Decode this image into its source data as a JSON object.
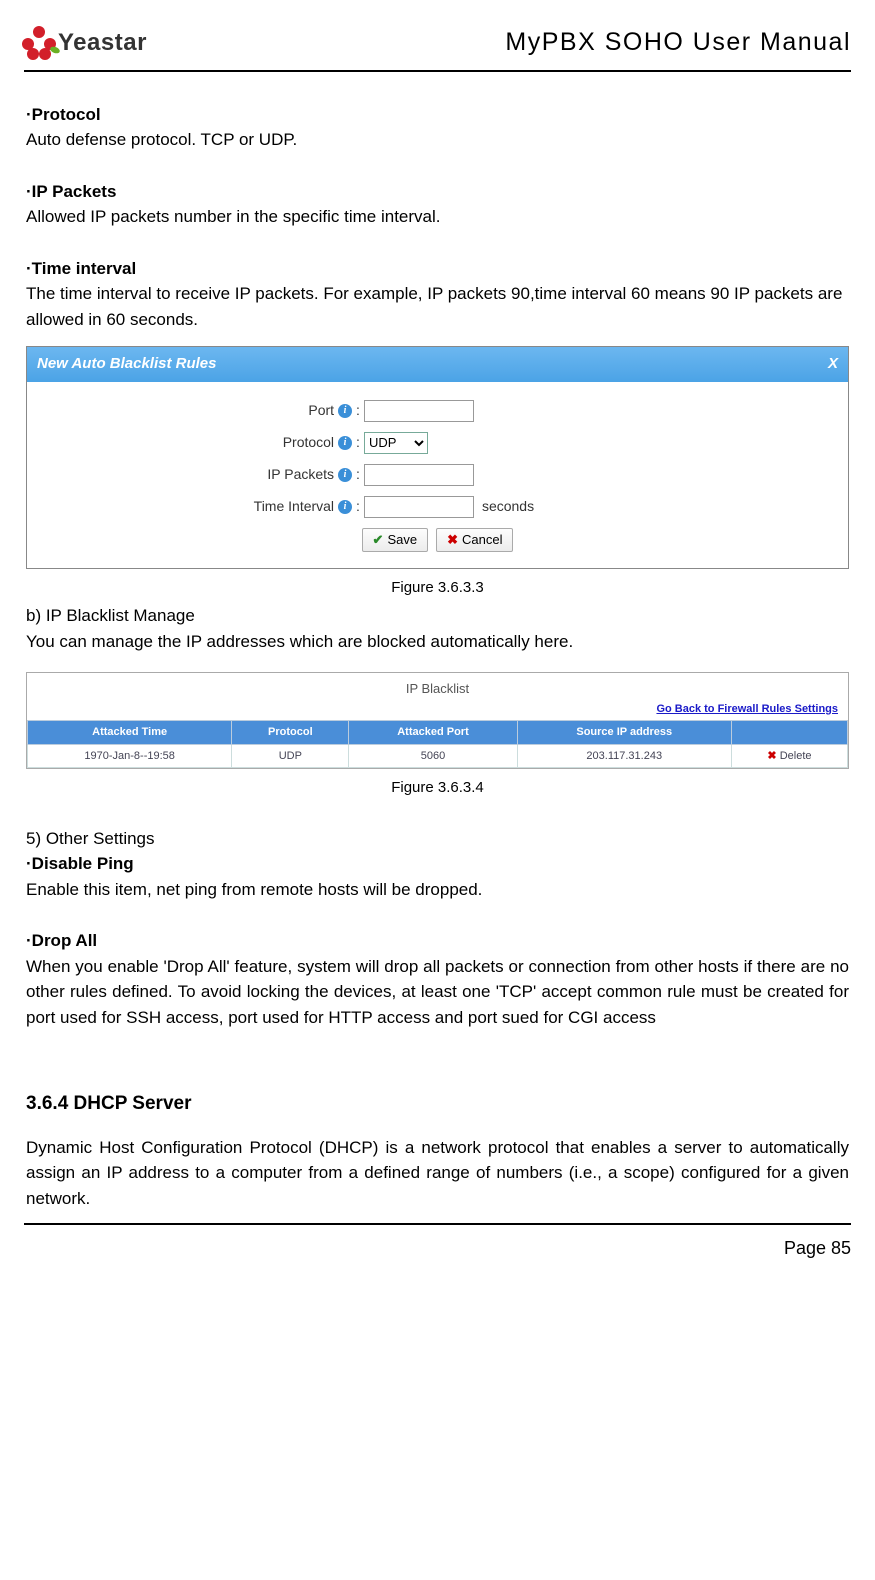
{
  "header": {
    "logo_text": "Yeastar",
    "doc_title": "MyPBX SOHO User Manual"
  },
  "sections": {
    "protocol": {
      "label": "·Protocol",
      "text": "Auto defense protocol. TCP or UDP."
    },
    "ip_packets": {
      "label": "·IP Packets",
      "text": "Allowed IP packets number in the specific time interval."
    },
    "time_interval": {
      "label": "·Time interval",
      "text": "The time interval to receive IP packets. For example, IP packets 90,time interval 60 means 90 IP packets are allowed in 60 seconds."
    }
  },
  "dialog1": {
    "title": "New Auto Blacklist Rules",
    "close": "X",
    "rows": {
      "port_label": "Port",
      "protocol_label": "Protocol",
      "protocol_value": "UDP",
      "ip_packets_label": "IP Packets",
      "time_interval_label": "Time Interval",
      "seconds_label": "seconds"
    },
    "buttons": {
      "save": "Save",
      "cancel": "Cancel"
    },
    "caption": "Figure 3.6.3.3"
  },
  "section_b": {
    "heading": "b)  IP Blacklist Manage",
    "text": "You can manage the IP addresses which are blocked automatically here."
  },
  "figure2": {
    "title": "IP Blacklist",
    "link": "Go Back to Firewall Rules Settings",
    "headers": {
      "time": "Attacked Time",
      "protocol": "Protocol",
      "port": "Attacked Port",
      "source": "Source IP address",
      "blank": ""
    },
    "row": {
      "time": "1970-Jan-8--19:58",
      "protocol": "UDP",
      "port": "5060",
      "source": "203.117.31.243",
      "delete": "Delete"
    },
    "caption": "Figure 3.6.3.4"
  },
  "section5": {
    "heading": "5) Other Settings",
    "disable_ping_label": "·Disable Ping",
    "disable_ping_text": "Enable this item, net ping from remote hosts will be dropped.",
    "drop_all_label": "·Drop All",
    "drop_all_text": "When you enable 'Drop All' feature, system will drop all packets or connection from other hosts if there are no other rules defined. To avoid locking the devices, at least one 'TCP' accept common rule must be created for port used for SSH access, port used for HTTP access and port sued for CGI access"
  },
  "dhcp": {
    "heading": "3.6.4 DHCP Server",
    "text": "Dynamic Host Configuration Protocol (DHCP) is a network protocol that enables a server to automatically assign an IP address to a computer from a defined range of numbers (i.e., a scope) configured for a given network."
  },
  "footer": {
    "page": "Page 85"
  }
}
